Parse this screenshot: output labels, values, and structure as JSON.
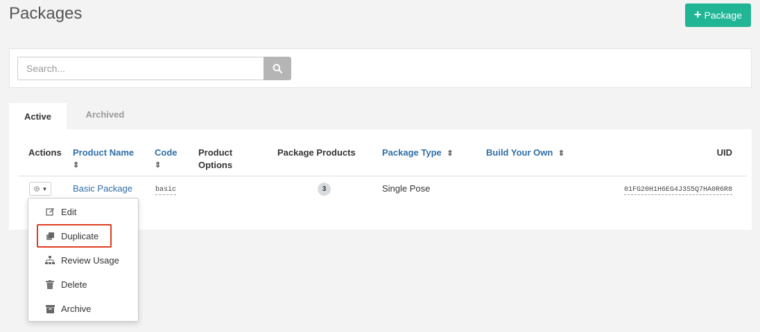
{
  "header": {
    "title": "Packages",
    "add_button_label": "Package"
  },
  "search": {
    "placeholder": "Search...",
    "button_icon": "search-icon"
  },
  "tabs": [
    {
      "label": "Active",
      "active": true
    },
    {
      "label": "Archived",
      "active": false
    }
  ],
  "table": {
    "columns": {
      "actions": "Actions",
      "product_name": "Product Name",
      "code": "Code",
      "product_options_line1": "Product",
      "product_options_line2": "Options",
      "package_products": "Package Products",
      "package_type": "Package Type",
      "build_your_own": "Build Your Own",
      "uid": "UID"
    },
    "rows": [
      {
        "product_name": "Basic Package",
        "code": "basic",
        "product_options": "",
        "package_products": "3",
        "package_type": "Single Pose",
        "build_your_own": "",
        "uid": "01FG20H1H6EG4J3S5Q7HA0R6R8"
      }
    ]
  },
  "actions_menu": {
    "items": [
      {
        "label": "Edit",
        "icon": "edit-icon"
      },
      {
        "label": "Duplicate",
        "icon": "duplicate-icon"
      },
      {
        "label": "Review Usage",
        "icon": "sitemap-icon"
      },
      {
        "label": "Delete",
        "icon": "trash-icon"
      },
      {
        "label": "Archive",
        "icon": "archive-icon"
      }
    ],
    "highlighted": "Duplicate"
  },
  "colors": {
    "primary_button": "#1fb595",
    "link": "#2f6fa6",
    "highlight_border": "#e03a1e"
  }
}
